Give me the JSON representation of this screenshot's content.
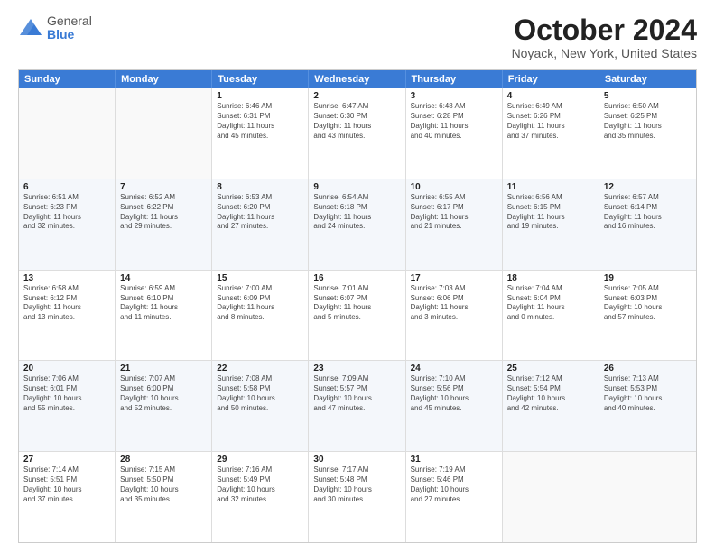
{
  "logo": {
    "general": "General",
    "blue": "Blue"
  },
  "title": "October 2024",
  "location": "Noyack, New York, United States",
  "weekdays": [
    "Sunday",
    "Monday",
    "Tuesday",
    "Wednesday",
    "Thursday",
    "Friday",
    "Saturday"
  ],
  "rows": [
    [
      {
        "day": "",
        "info": ""
      },
      {
        "day": "",
        "info": ""
      },
      {
        "day": "1",
        "info": "Sunrise: 6:46 AM\nSunset: 6:31 PM\nDaylight: 11 hours\nand 45 minutes."
      },
      {
        "day": "2",
        "info": "Sunrise: 6:47 AM\nSunset: 6:30 PM\nDaylight: 11 hours\nand 43 minutes."
      },
      {
        "day": "3",
        "info": "Sunrise: 6:48 AM\nSunset: 6:28 PM\nDaylight: 11 hours\nand 40 minutes."
      },
      {
        "day": "4",
        "info": "Sunrise: 6:49 AM\nSunset: 6:26 PM\nDaylight: 11 hours\nand 37 minutes."
      },
      {
        "day": "5",
        "info": "Sunrise: 6:50 AM\nSunset: 6:25 PM\nDaylight: 11 hours\nand 35 minutes."
      }
    ],
    [
      {
        "day": "6",
        "info": "Sunrise: 6:51 AM\nSunset: 6:23 PM\nDaylight: 11 hours\nand 32 minutes."
      },
      {
        "day": "7",
        "info": "Sunrise: 6:52 AM\nSunset: 6:22 PM\nDaylight: 11 hours\nand 29 minutes."
      },
      {
        "day": "8",
        "info": "Sunrise: 6:53 AM\nSunset: 6:20 PM\nDaylight: 11 hours\nand 27 minutes."
      },
      {
        "day": "9",
        "info": "Sunrise: 6:54 AM\nSunset: 6:18 PM\nDaylight: 11 hours\nand 24 minutes."
      },
      {
        "day": "10",
        "info": "Sunrise: 6:55 AM\nSunset: 6:17 PM\nDaylight: 11 hours\nand 21 minutes."
      },
      {
        "day": "11",
        "info": "Sunrise: 6:56 AM\nSunset: 6:15 PM\nDaylight: 11 hours\nand 19 minutes."
      },
      {
        "day": "12",
        "info": "Sunrise: 6:57 AM\nSunset: 6:14 PM\nDaylight: 11 hours\nand 16 minutes."
      }
    ],
    [
      {
        "day": "13",
        "info": "Sunrise: 6:58 AM\nSunset: 6:12 PM\nDaylight: 11 hours\nand 13 minutes."
      },
      {
        "day": "14",
        "info": "Sunrise: 6:59 AM\nSunset: 6:10 PM\nDaylight: 11 hours\nand 11 minutes."
      },
      {
        "day": "15",
        "info": "Sunrise: 7:00 AM\nSunset: 6:09 PM\nDaylight: 11 hours\nand 8 minutes."
      },
      {
        "day": "16",
        "info": "Sunrise: 7:01 AM\nSunset: 6:07 PM\nDaylight: 11 hours\nand 5 minutes."
      },
      {
        "day": "17",
        "info": "Sunrise: 7:03 AM\nSunset: 6:06 PM\nDaylight: 11 hours\nand 3 minutes."
      },
      {
        "day": "18",
        "info": "Sunrise: 7:04 AM\nSunset: 6:04 PM\nDaylight: 11 hours\nand 0 minutes."
      },
      {
        "day": "19",
        "info": "Sunrise: 7:05 AM\nSunset: 6:03 PM\nDaylight: 10 hours\nand 57 minutes."
      }
    ],
    [
      {
        "day": "20",
        "info": "Sunrise: 7:06 AM\nSunset: 6:01 PM\nDaylight: 10 hours\nand 55 minutes."
      },
      {
        "day": "21",
        "info": "Sunrise: 7:07 AM\nSunset: 6:00 PM\nDaylight: 10 hours\nand 52 minutes."
      },
      {
        "day": "22",
        "info": "Sunrise: 7:08 AM\nSunset: 5:58 PM\nDaylight: 10 hours\nand 50 minutes."
      },
      {
        "day": "23",
        "info": "Sunrise: 7:09 AM\nSunset: 5:57 PM\nDaylight: 10 hours\nand 47 minutes."
      },
      {
        "day": "24",
        "info": "Sunrise: 7:10 AM\nSunset: 5:56 PM\nDaylight: 10 hours\nand 45 minutes."
      },
      {
        "day": "25",
        "info": "Sunrise: 7:12 AM\nSunset: 5:54 PM\nDaylight: 10 hours\nand 42 minutes."
      },
      {
        "day": "26",
        "info": "Sunrise: 7:13 AM\nSunset: 5:53 PM\nDaylight: 10 hours\nand 40 minutes."
      }
    ],
    [
      {
        "day": "27",
        "info": "Sunrise: 7:14 AM\nSunset: 5:51 PM\nDaylight: 10 hours\nand 37 minutes."
      },
      {
        "day": "28",
        "info": "Sunrise: 7:15 AM\nSunset: 5:50 PM\nDaylight: 10 hours\nand 35 minutes."
      },
      {
        "day": "29",
        "info": "Sunrise: 7:16 AM\nSunset: 5:49 PM\nDaylight: 10 hours\nand 32 minutes."
      },
      {
        "day": "30",
        "info": "Sunrise: 7:17 AM\nSunset: 5:48 PM\nDaylight: 10 hours\nand 30 minutes."
      },
      {
        "day": "31",
        "info": "Sunrise: 7:19 AM\nSunset: 5:46 PM\nDaylight: 10 hours\nand 27 minutes."
      },
      {
        "day": "",
        "info": ""
      },
      {
        "day": "",
        "info": ""
      }
    ]
  ]
}
